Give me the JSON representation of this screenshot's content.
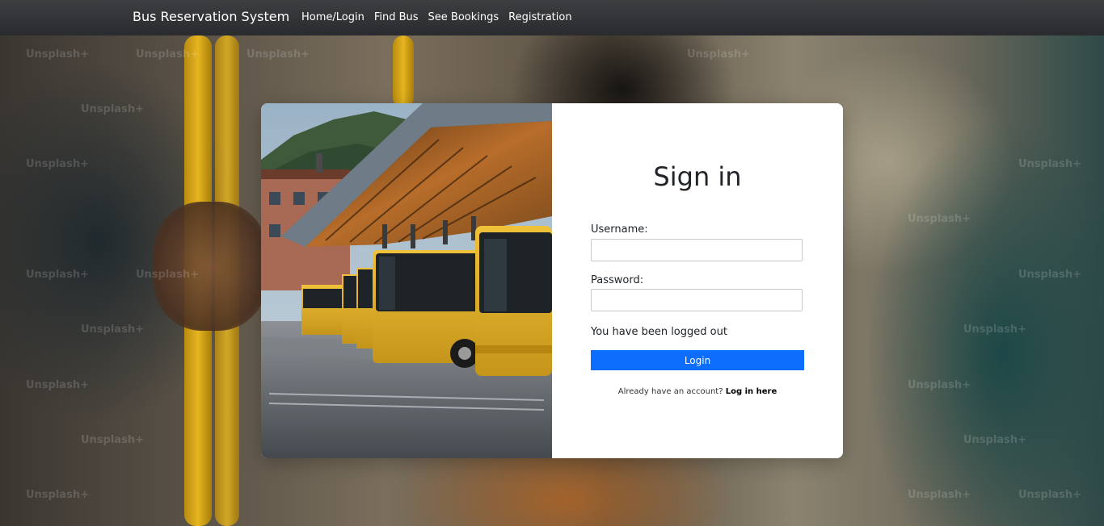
{
  "navbar": {
    "brand": "Bus Reservation System",
    "links": [
      {
        "label": "Home/Login"
      },
      {
        "label": "Find Bus"
      },
      {
        "label": "See Bookings"
      },
      {
        "label": "Registration"
      }
    ]
  },
  "background": {
    "watermark_text": "Unsplash+"
  },
  "login": {
    "title": "Sign in",
    "username_label": "Username:",
    "username_value": "",
    "password_label": "Password:",
    "password_value": "",
    "status_message": "You have been logged out",
    "submit_label": "Login",
    "footer_text": "Already have an account?",
    "footer_link": "Log in here"
  },
  "colors": {
    "navbar": "#2f3033",
    "primary_button": "#0d6efd",
    "bus_yellow": "#e0b020"
  }
}
